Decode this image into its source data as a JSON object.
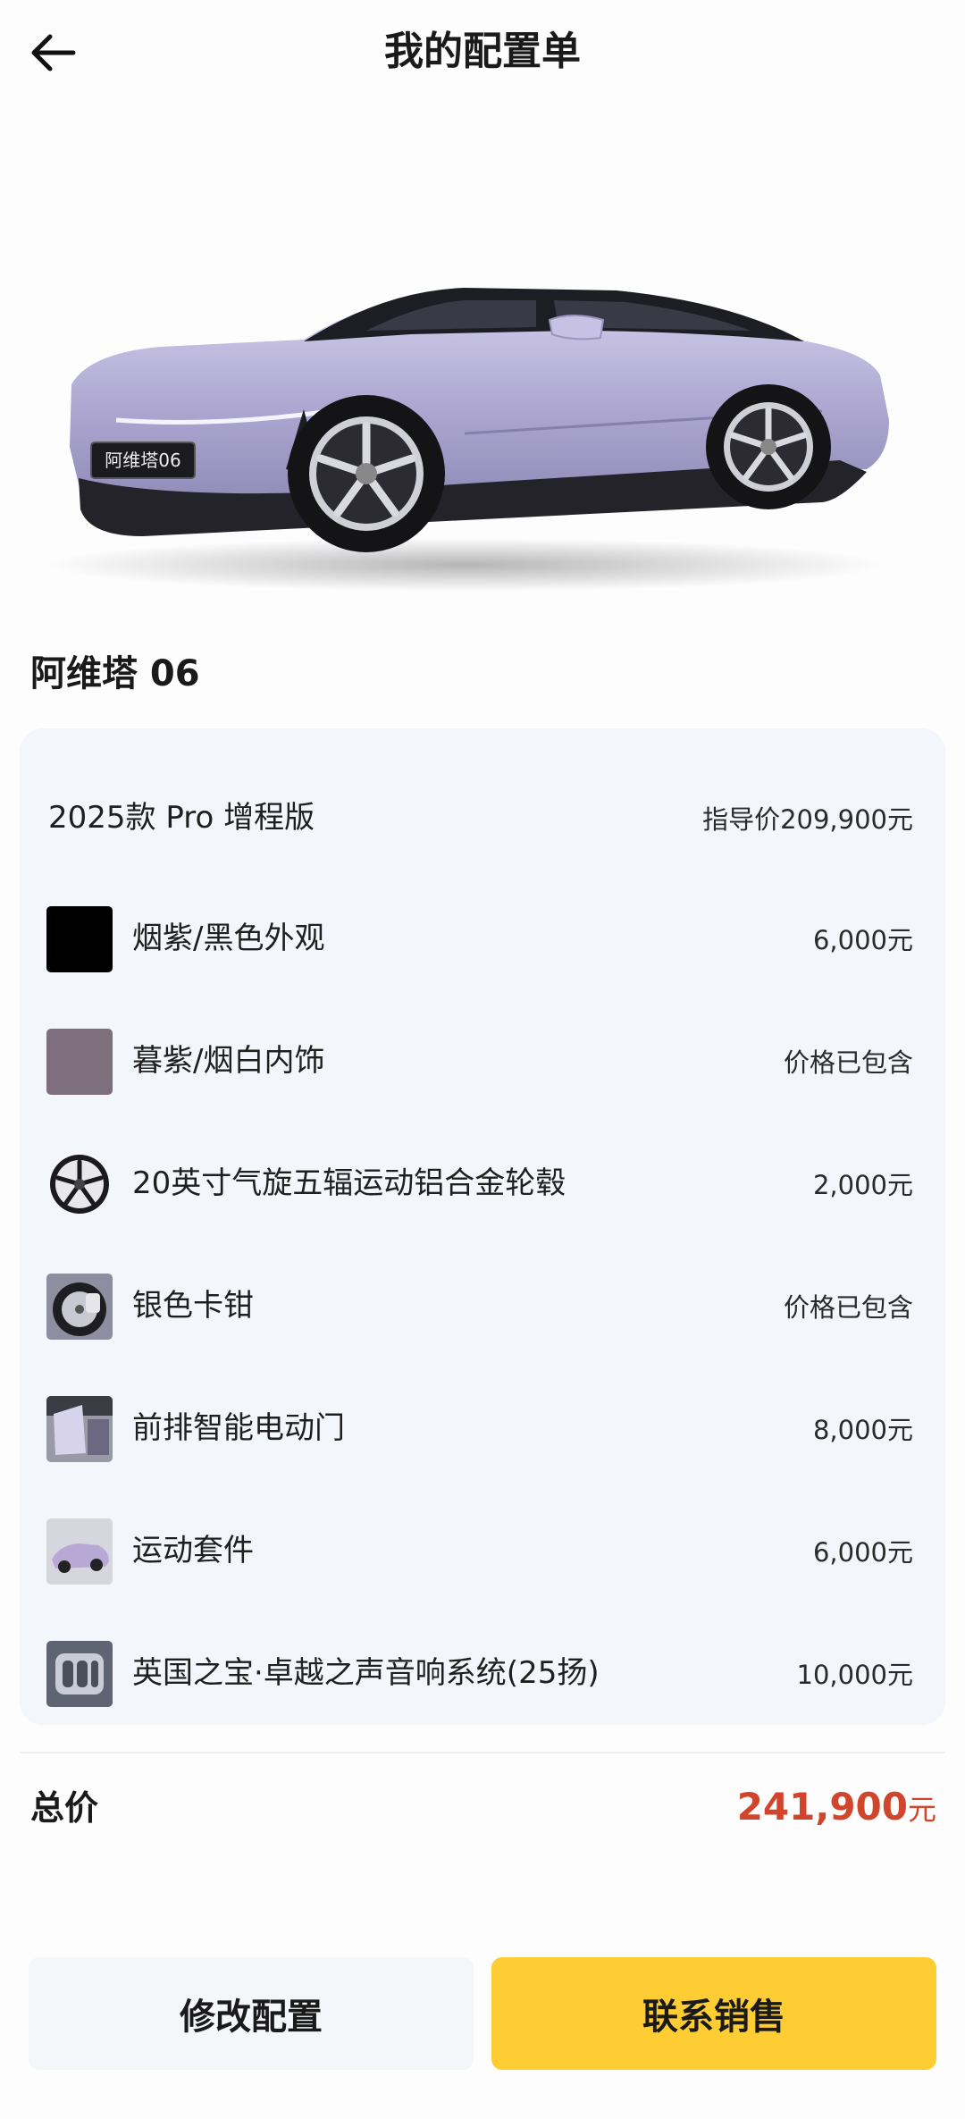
{
  "header": {
    "title": "我的配置单",
    "back_icon": "arrow-left-icon"
  },
  "vehicle": {
    "name": "阿维塔 06",
    "plate": "阿维塔06",
    "body_color": "#b3aed6"
  },
  "config": {
    "base": {
      "label": "2025款 Pro 增程版",
      "price": "指导价209,900元"
    },
    "items": [
      {
        "label": "烟紫/黑色外观",
        "price": "6,000元",
        "thumb": "black-swatch",
        "color": "#000000"
      },
      {
        "label": "暮紫/烟白内饰",
        "price": "价格已包含",
        "thumb": "mauve-swatch",
        "color": "#7d6f7e"
      },
      {
        "label": "20英寸气旋五辐运动铝合金轮毂",
        "price": "2,000元",
        "thumb": "wheel-icon"
      },
      {
        "label": "银色卡钳",
        "price": "价格已包含",
        "thumb": "caliper-photo"
      },
      {
        "label": "前排智能电动门",
        "price": "8,000元",
        "thumb": "door-photo"
      },
      {
        "label": "运动套件",
        "price": "6,000元",
        "thumb": "sport-kit-photo"
      },
      {
        "label": "英国之宝·卓越之声音响系统(25扬)",
        "price": "10,000元",
        "thumb": "audio-photo"
      }
    ]
  },
  "total": {
    "label": "总价",
    "value": "241,900",
    "unit": "元",
    "color": "#d0452c"
  },
  "actions": {
    "edit": "修改配置",
    "contact": "联系销售",
    "contact_color": "#fdcd33"
  }
}
